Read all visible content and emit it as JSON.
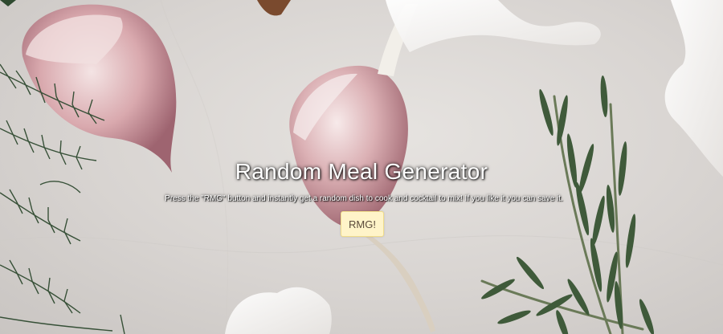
{
  "hero": {
    "title": "Random Meal Generator",
    "description": "Press the \"RMG\" button and instantly get a random dish to cook and cocktail to mix! If you like it you can save it.",
    "button_label": "RMG!"
  },
  "colors": {
    "button_bg": "#fff4c9",
    "button_text": "#5a4a3a",
    "heading_text": "#ffffff",
    "marble_bg": "#dcd9d6"
  },
  "background_image": {
    "icon": "garlic-and-herbs-photo"
  }
}
